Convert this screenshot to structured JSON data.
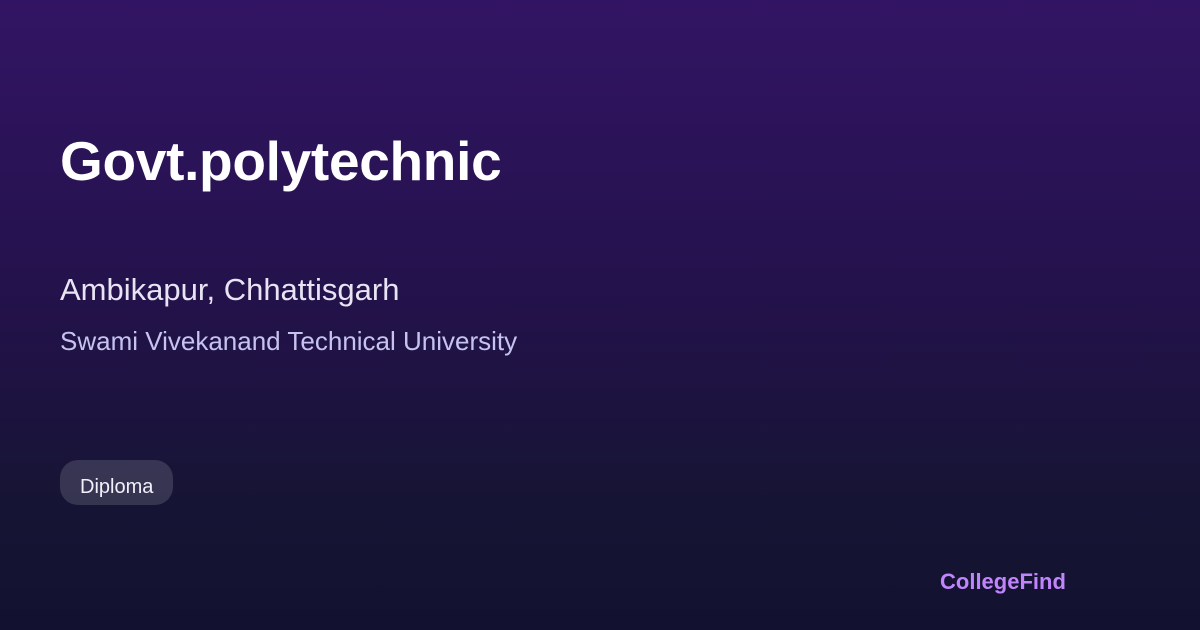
{
  "college": {
    "name": "Govt.polytechnic",
    "location": "Ambikapur, Chhattisgarh",
    "university": "Swami Vivekanand Technical University",
    "badge": "Diploma"
  },
  "brand": {
    "name": "CollegeFind"
  },
  "colors": {
    "background_top": "#321464",
    "background_bottom": "#121230",
    "brand_accent": "#c084fc",
    "university_text": "#c6c4ee"
  }
}
